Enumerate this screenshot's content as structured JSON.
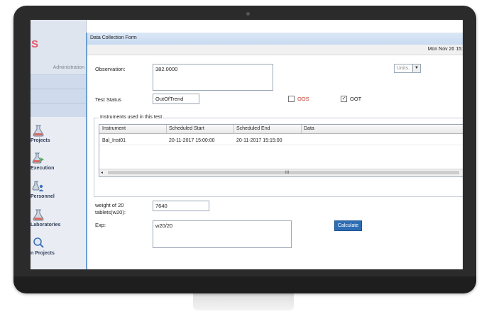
{
  "app": {
    "logo": "S",
    "role": "Administration"
  },
  "sidebar": {
    "items": [
      {
        "label": "Projects",
        "icon": "flask-icon"
      },
      {
        "label": "Execution",
        "icon": "flask-arrow-icon"
      },
      {
        "label": "Personnel",
        "icon": "people-icon"
      },
      {
        "label": "Laboratories",
        "icon": "flask-icon"
      },
      {
        "label": "n Projects",
        "icon": "search-icon"
      }
    ]
  },
  "form": {
    "title": "Data Collection Form",
    "date": "Mon Nov 20 15:",
    "observation_label": "Observation:",
    "observation_value": "382.0000",
    "units_placeholder": "Units..",
    "test_status_label": "Test Status",
    "test_status_value": "OutOfTrend",
    "oos_label": "OOS",
    "oos_checked": false,
    "oot_label": "OOT",
    "oot_checked": true,
    "instruments_group_label": "Instruments used in this test",
    "grid": {
      "columns": [
        "Instrument",
        "Scheduled Start",
        "Scheduled End",
        "Data"
      ],
      "rows": [
        {
          "instrument": "Bal_Inst01",
          "start": "20-11-2017 15:00:00",
          "end": "20-11-2017 15:15:00",
          "data": ""
        }
      ],
      "scroll_grip": "III"
    },
    "weight_label_line1": "weight of 20",
    "weight_label_line2": "tablets(w20):",
    "weight_value": "7640",
    "exp_label": "Exp:",
    "exp_value": "w20/20",
    "calculate_label": "Calculate"
  },
  "colors": {
    "accent": "#2d6db5",
    "title_bar": "#c8dbf1",
    "logo": "#e25a6e"
  }
}
